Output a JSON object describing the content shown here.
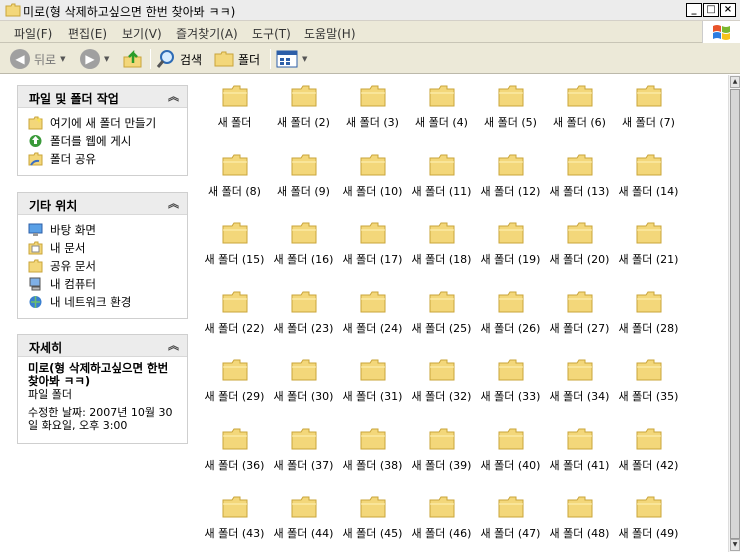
{
  "window": {
    "title": "미로(형 삭제하고싶으면 한번 찾아봐 ㅋㅋ)",
    "minimize_glyph": "_",
    "maximize_glyph": "□",
    "close_glyph": "×"
  },
  "menu": [
    {
      "label": "파일(F)"
    },
    {
      "label": "편집(E)"
    },
    {
      "label": "보기(V)"
    },
    {
      "label": "즐겨찾기(A)"
    },
    {
      "label": "도구(T)"
    },
    {
      "label": "도움말(H)"
    }
  ],
  "toolbar": {
    "back_label": "뒤로",
    "search_label": "검색",
    "folders_label": "폴더"
  },
  "tasks": {
    "title": "파일 및 폴더 작업",
    "items": [
      {
        "label": "여기에 새 폴더 만들기",
        "icon": "new-folder-icon"
      },
      {
        "label": "폴더를 웹에 게시",
        "icon": "publish-web-icon"
      },
      {
        "label": "폴더 공유",
        "icon": "share-folder-icon"
      }
    ]
  },
  "places": {
    "title": "기타 위치",
    "items": [
      {
        "label": "바탕 화면",
        "icon": "desktop-icon"
      },
      {
        "label": "내 문서",
        "icon": "my-documents-icon"
      },
      {
        "label": "공유 문서",
        "icon": "shared-documents-icon"
      },
      {
        "label": "내 컴퓨터",
        "icon": "my-computer-icon"
      },
      {
        "label": "내 네트워크 환경",
        "icon": "my-network-icon"
      }
    ]
  },
  "details": {
    "title": "자세히",
    "name": "미로(형 삭제하고싶으면 한번 찾아봐 ㅋㅋ)",
    "type": "파일 폴더",
    "modified": "수정한 날짜: 2007년 10월 30일 화요일, 오후 3:00"
  },
  "folders": [
    "새 폴더",
    "새 폴더 (2)",
    "새 폴더 (3)",
    "새 폴더 (4)",
    "새 폴더 (5)",
    "새 폴더 (6)",
    "새 폴더 (7)",
    "새 폴더 (8)",
    "새 폴더 (9)",
    "새 폴더 (10)",
    "새 폴더 (11)",
    "새 폴더 (12)",
    "새 폴더 (13)",
    "새 폴더 (14)",
    "새 폴더 (15)",
    "새 폴더 (16)",
    "새 폴더 (17)",
    "새 폴더 (18)",
    "새 폴더 (19)",
    "새 폴더 (20)",
    "새 폴더 (21)",
    "새 폴더 (22)",
    "새 폴더 (23)",
    "새 폴더 (24)",
    "새 폴더 (25)",
    "새 폴더 (26)",
    "새 폴더 (27)",
    "새 폴더 (28)",
    "새 폴더 (29)",
    "새 폴더 (30)",
    "새 폴더 (31)",
    "새 폴더 (32)",
    "새 폴더 (33)",
    "새 폴더 (34)",
    "새 폴더 (35)",
    "새 폴더 (36)",
    "새 폴더 (37)",
    "새 폴더 (38)",
    "새 폴더 (39)",
    "새 폴더 (40)",
    "새 폴더 (41)",
    "새 폴더 (42)",
    "새 폴더 (43)",
    "새 폴더 (44)",
    "새 폴더 (45)",
    "새 폴더 (46)",
    "새 폴더 (47)",
    "새 폴더 (48)",
    "새 폴더 (49)"
  ],
  "colors": {
    "folder_fill": "#f3d77a",
    "folder_edge": "#c9a43a",
    "chrome": "#ece9d8"
  }
}
